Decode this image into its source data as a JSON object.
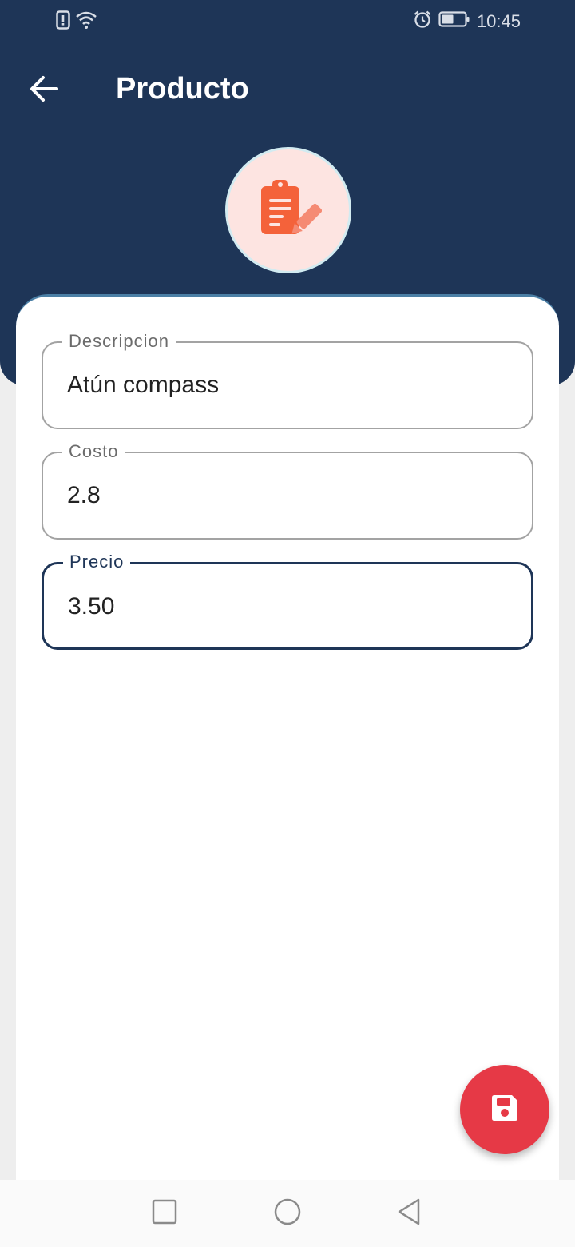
{
  "status_bar": {
    "time": "10:45",
    "icons": [
      "alert-icon",
      "wifi-icon",
      "alarm-icon",
      "battery-icon"
    ]
  },
  "app_bar": {
    "title": "Producto",
    "back_icon": "arrow-left-icon"
  },
  "avatar": {
    "icon": "clipboard-edit-icon"
  },
  "form": {
    "fields": [
      {
        "label": "Descripcion",
        "value": "Atún compass",
        "focused": false
      },
      {
        "label": "Costo",
        "value": "2.8",
        "focused": false
      },
      {
        "label": "Precio",
        "value": "3.50",
        "focused": true
      }
    ]
  },
  "fab": {
    "icon": "save-icon"
  },
  "nav_bar": {
    "icons": [
      "recents-square-icon",
      "home-circle-icon",
      "back-triangle-icon"
    ]
  },
  "colors": {
    "primary": "#1e3557",
    "accent": "#e63946",
    "avatar_bg": "#fde4e1",
    "icon_orange": "#f4623a"
  }
}
